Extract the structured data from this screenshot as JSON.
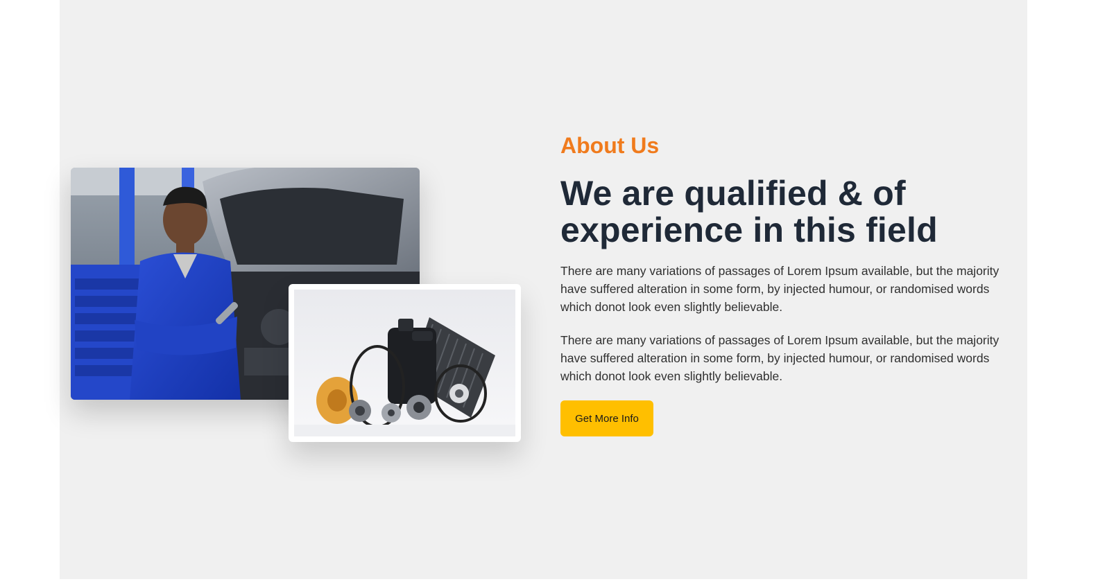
{
  "about": {
    "eyebrow": "About Us",
    "headline": "We are qualified & of experience in this field",
    "paragraphs": [
      "There are many variations of passages of Lorem Ipsum available, but the majority have suffered alteration in some form, by injected humour, or randomised words which donot look even slightly believable.",
      "There are many variations of passages of Lorem Ipsum available, but the majority have suffered alteration in some form, by injected humour, or randomised words which donot look even slightly believable."
    ],
    "cta_label": "Get More Info"
  },
  "images": {
    "main_photo": "mechanic-with-wrench-photo",
    "secondary_photo": "car-parts-photo"
  },
  "colors": {
    "accent_orange": "#f07b1d",
    "heading_dark": "#1f2937",
    "button_yellow": "#ffbf00",
    "panel_bg": "#f0f0f0"
  }
}
